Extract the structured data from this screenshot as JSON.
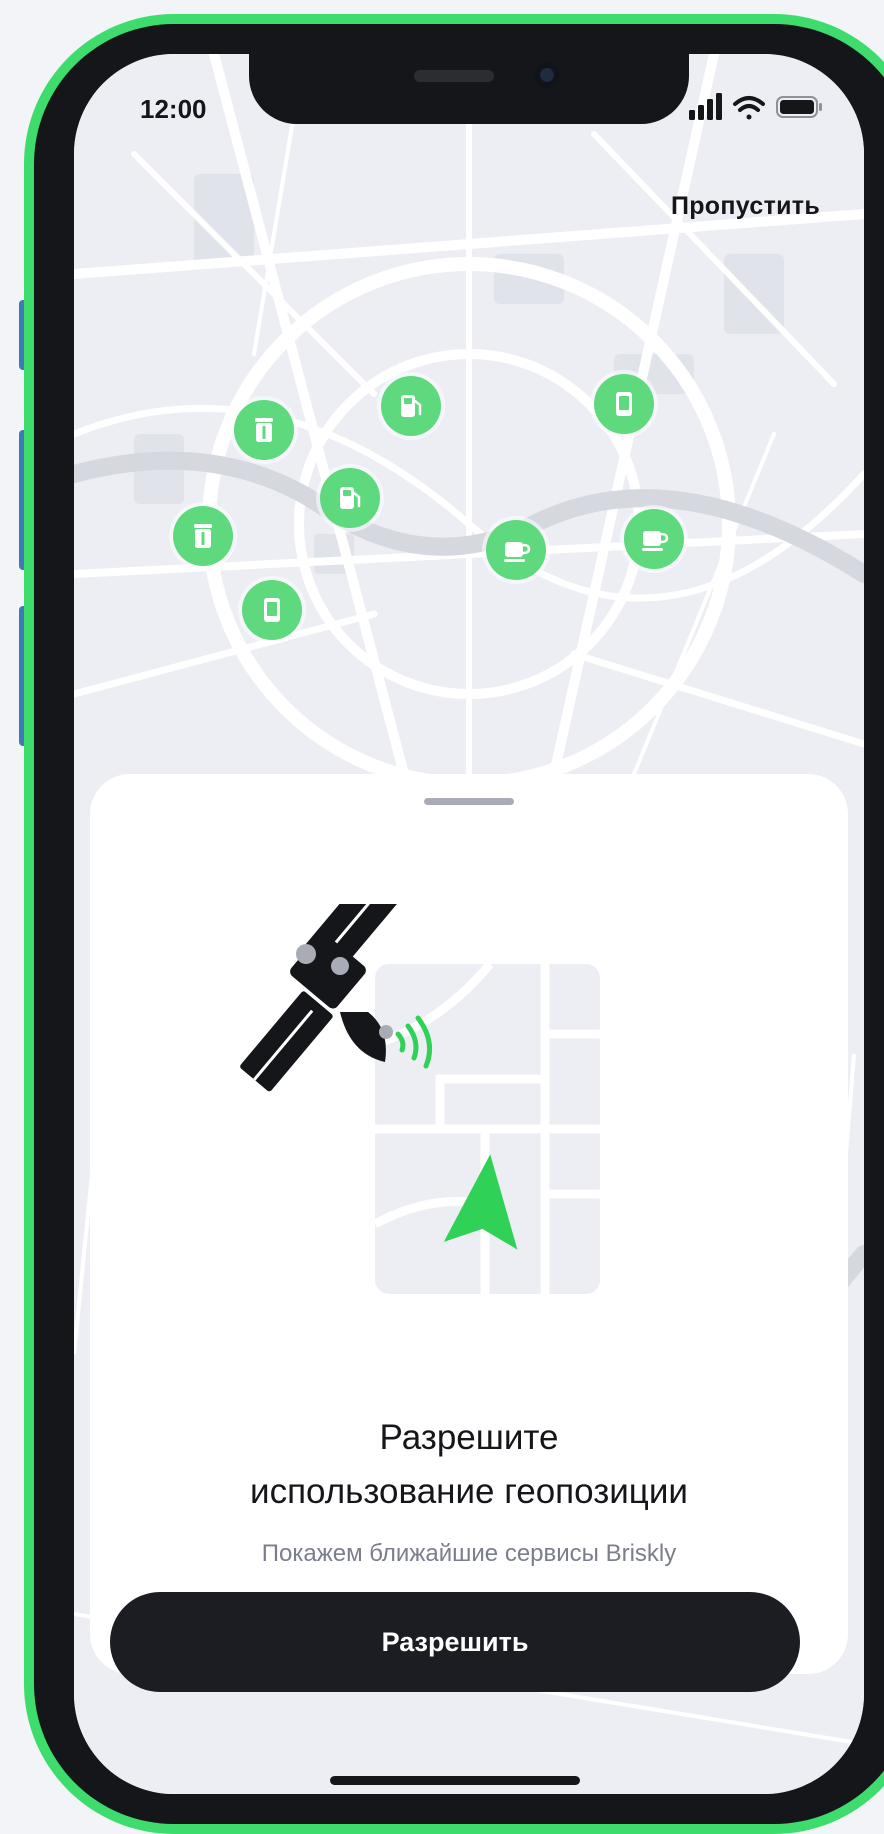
{
  "status_bar": {
    "time": "12:00"
  },
  "header": {
    "skip_label": "Пропустить"
  },
  "map": {
    "markers": [
      {
        "icon": "fuel-pump-icon"
      },
      {
        "icon": "phone-icon"
      },
      {
        "icon": "trash-bin-icon"
      },
      {
        "icon": "fuel-pump-icon"
      },
      {
        "icon": "trash-bin-icon"
      },
      {
        "icon": "coffee-cup-icon"
      },
      {
        "icon": "coffee-cup-icon"
      },
      {
        "icon": "phone-icon"
      }
    ]
  },
  "sheet": {
    "title_line1": "Разрешите",
    "title_line2": "использование геопозиции",
    "subtitle": "Покажем ближайшие сервисы Briskly",
    "allow_label": "Разрешить"
  },
  "colors": {
    "accent": "#3ddc6c",
    "marker": "#5fd97e",
    "button": "#1c1d22",
    "background": "#f3f4f8"
  }
}
